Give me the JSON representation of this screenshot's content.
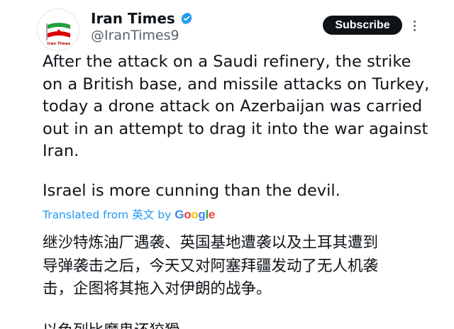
{
  "account": {
    "display_name": "Iran Times",
    "handle": "@IranTimes9",
    "verified": true,
    "avatar_text": "Iran Times"
  },
  "actions": {
    "subscribe_label": "Subscribe",
    "more_icon": "more-vertical-icon"
  },
  "tweet": {
    "paragraph1": "After the attack on a Saudi refinery, the strike\non a British base, and missile attacks on Turkey,\ntoday a drone attack on Azerbaijan was carried\nout in an attempt to drag it into the war against\nIran.",
    "paragraph2": "Israel is more cunning than the devil."
  },
  "translation": {
    "prefix": "Translated from",
    "source_language": "英文",
    "by": "by",
    "provider": "Google",
    "translated_paragraph1": "继沙特炼油厂遇袭、英国基地遭袭以及土耳其遭到\n导弹袭击之后，今天又对阿塞拜疆发动了无人机袭\n击，企图将其拖入对伊朗的战争。",
    "translated_paragraph2_partial": "以色列比魔鬼还狡猾"
  },
  "colors": {
    "link": "#1d9bf0",
    "text": "#0f1419",
    "secondary": "#536471",
    "verified": "#1d9bf0",
    "google_blue": "#4285f4",
    "google_red": "#ea4335",
    "google_yellow": "#fbbc05",
    "google_green": "#34a853"
  }
}
